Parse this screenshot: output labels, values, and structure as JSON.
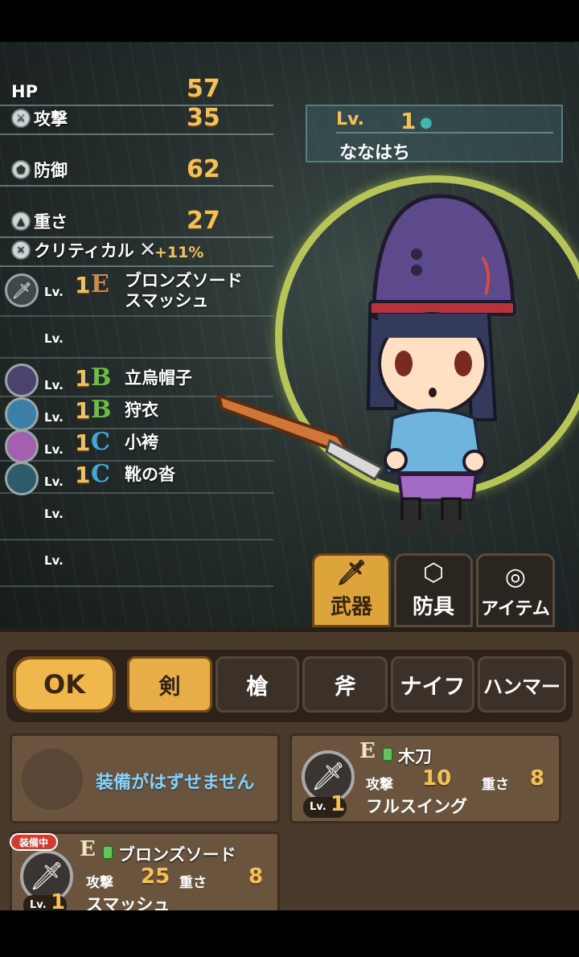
{
  "stats": {
    "hp": {
      "label": "HP",
      "value": "57"
    },
    "attack": {
      "label": "攻撃",
      "value": "35"
    },
    "defense": {
      "label": "防御",
      "value": "62"
    },
    "weight": {
      "label": "重さ",
      "value": "27"
    },
    "critical": {
      "label": "クリティカル",
      "value": "+11%"
    }
  },
  "equipment": [
    {
      "slot": "weapon",
      "lv_label": "Lv.",
      "level": "1",
      "rank": "E",
      "name_line1": "ブロンズソード",
      "name_line2": "スマッシュ",
      "icon": "sword-icon"
    },
    {
      "slot": "accessory",
      "lv_label": "Lv.",
      "level": "",
      "rank": "",
      "name_line1": "",
      "name_line2": ""
    },
    {
      "slot": "head",
      "lv_label": "Lv.",
      "level": "1",
      "rank": "B",
      "name_line1": "立烏帽子",
      "icon": "hat-icon"
    },
    {
      "slot": "body",
      "lv_label": "Lv.",
      "level": "1",
      "rank": "B",
      "name_line1": "狩衣",
      "icon": "robe-icon"
    },
    {
      "slot": "legs",
      "lv_label": "Lv.",
      "level": "1",
      "rank": "C",
      "name_line1": "小袴",
      "icon": "pants-icon"
    },
    {
      "slot": "feet",
      "lv_label": "Lv.",
      "level": "1",
      "rank": "C",
      "name_line1": "靴の沓",
      "icon": "shoes-icon"
    },
    {
      "slot": "extra1",
      "lv_label": "Lv."
    },
    {
      "slot": "extra2",
      "lv_label": "Lv."
    }
  ],
  "character": {
    "lv_label": "Lv.",
    "level": "1",
    "name": "ななはち"
  },
  "category_tabs": [
    {
      "label": "武器",
      "icon": "sword-icon",
      "active": true
    },
    {
      "label": "防具",
      "icon": "hexagon-shield-icon",
      "active": false
    },
    {
      "label": "アイテム",
      "icon": "item-ring-icon",
      "active": false
    }
  ],
  "ok_button": "OK",
  "weapon_tabs": [
    {
      "label": "剣",
      "active": true
    },
    {
      "label": "槍",
      "active": false
    },
    {
      "label": "斧",
      "active": false
    },
    {
      "label": "ナイフ",
      "active": false
    },
    {
      "label": "ハンマー",
      "active": false
    }
  ],
  "cards": {
    "unequip": {
      "text": "装備がはずせません"
    },
    "bokken": {
      "rank": "E",
      "name": "木刀",
      "attack_label": "攻撃",
      "attack": "10",
      "weight_label": "重さ",
      "weight": "8",
      "lv_label": "Lv.",
      "level": "1",
      "skill": "フルスイング"
    },
    "bronze": {
      "badge": "装備中",
      "rank": "E",
      "name": "ブロンズソード",
      "attack_label": "攻撃",
      "attack": "25",
      "weight_label": "重さ",
      "weight": "8",
      "lv_label": "Lv.",
      "level": "1",
      "skill": "スマッシュ"
    }
  }
}
